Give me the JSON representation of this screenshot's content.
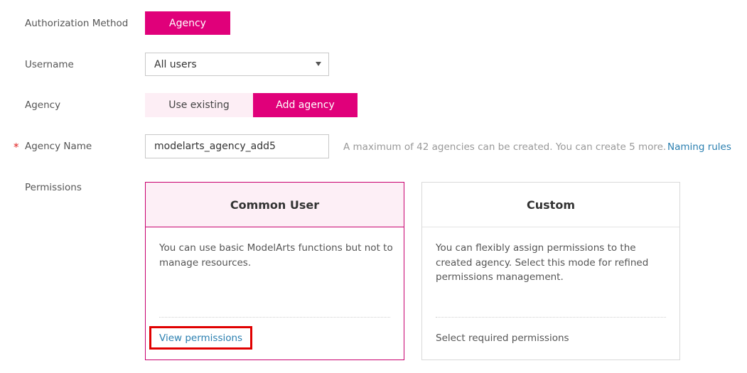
{
  "form": {
    "auth_method": {
      "label": "Authorization Method",
      "value": "Agency"
    },
    "username": {
      "label": "Username",
      "value": "All users"
    },
    "agency": {
      "label": "Agency",
      "options": [
        "Use existing",
        "Add agency"
      ],
      "selected": "Add agency"
    },
    "agency_name": {
      "label": "Agency Name",
      "required_mark": "*",
      "value": "modelarts_agency_add5",
      "hint": "A maximum of 42 agencies can be created. You can create 5 more.",
      "link": "Naming rules"
    },
    "permissions": {
      "label": "Permissions",
      "cards": [
        {
          "title": "Common User",
          "description": "You can use basic ModelArts functions but not to manage resources.",
          "footer": "View permissions",
          "selected": true
        },
        {
          "title": "Custom",
          "description": "You can flexibly assign permissions to the created agency. Select this mode for refined permissions management.",
          "footer": "Select required permissions",
          "selected": false
        }
      ]
    }
  },
  "colors": {
    "accent": "#e0007a",
    "accent_light": "#fdeef5",
    "link": "#2a7fb0",
    "highlight": "#e00000"
  }
}
